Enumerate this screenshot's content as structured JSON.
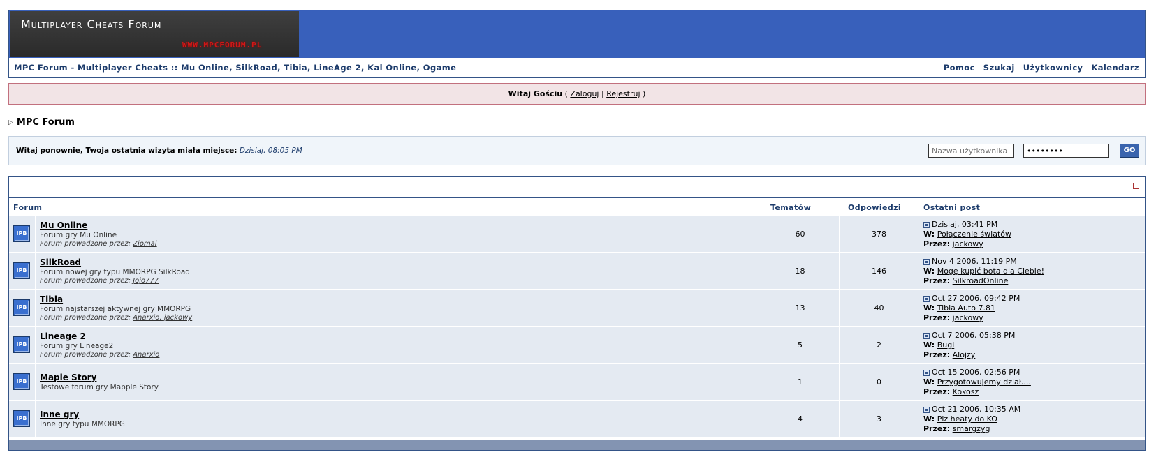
{
  "header": {
    "logo_title": "Multiplayer Cheats Forum",
    "logo_url": "WWW.MPCFORUM.PL",
    "site_title": "MPC Forum - Multiplayer Cheats :: Mu Online, SilkRoad, Tibia, LineAge 2, Kal Online, Ogame",
    "nav": [
      "Pomoc",
      "Szukaj",
      "Użytkownicy",
      "Kalendarz"
    ]
  },
  "guest": {
    "greeting": "Witaj Gościu",
    "open": " ( ",
    "login": "Zaloguj",
    "sep": " | ",
    "register": "Rejestruj",
    "close": " )"
  },
  "breadcrumb": {
    "title": "MPC Forum"
  },
  "welcome": {
    "text": "Witaj ponownie, Twoja ostatnia wizyta miała miejsce:",
    "date": "Dzisiaj, 08:05 PM",
    "username_placeholder": "Nazwa użytkownika",
    "password_value": "••••••••",
    "go_label": "GO"
  },
  "table": {
    "headers": {
      "forum": "Forum",
      "topics": "Tematów",
      "replies": "Odpowiedzi",
      "last": "Ostatni post"
    },
    "icon_label": "IPB",
    "mod_prefix": "Forum prowadzone przez:",
    "w_label": "W:",
    "by_label": "Przez:",
    "rows": [
      {
        "name": "Mu Online",
        "desc": "Forum gry Mu Online",
        "mods": "Ziomal",
        "topics": "60",
        "replies": "378",
        "date": "Dzisiaj, 03:41 PM",
        "post": "Połączenie światów",
        "author": "jackowy"
      },
      {
        "name": "SilkRoad",
        "desc": "Forum nowej gry typu MMORPG SilkRoad",
        "mods": "Jojo777",
        "topics": "18",
        "replies": "146",
        "date": "Nov 4 2006, 11:19 PM",
        "post": "Mogę kupić bota dla Ciebie!",
        "author": "SilkroadOnline"
      },
      {
        "name": "Tibia",
        "desc": "Forum najstarszej aktywnej gry MMORPG",
        "mods": "Anarxio, jackowy",
        "topics": "13",
        "replies": "40",
        "date": "Oct 27 2006, 09:42 PM",
        "post": "Tibia Auto 7.81",
        "author": "jackowy"
      },
      {
        "name": "Lineage 2",
        "desc": "Forum gry Lineage2",
        "mods": "Anarxio",
        "topics": "5",
        "replies": "2",
        "date": "Oct 7 2006, 05:38 PM",
        "post": "Bugi",
        "author": "Alojzy"
      },
      {
        "name": "Maple Story",
        "desc": "Testowe forum gry Mapple Story",
        "mods": "",
        "topics": "1",
        "replies": "0",
        "date": "Oct 15 2006, 02:56 PM",
        "post": "Przygotowujemy dział....",
        "author": "Kokosz"
      },
      {
        "name": "Inne gry",
        "desc": "Inne gry typu MMORPG",
        "mods": "",
        "topics": "4",
        "replies": "3",
        "date": "Oct 21 2006, 10:35 AM",
        "post": "Plz heaty do KO",
        "author": "smargzyg"
      }
    ]
  },
  "colors": {
    "banner": "#3860bb",
    "border": "#345487",
    "row_bg": "#e4eaf2",
    "guest_bg": "#f2e4e6"
  }
}
